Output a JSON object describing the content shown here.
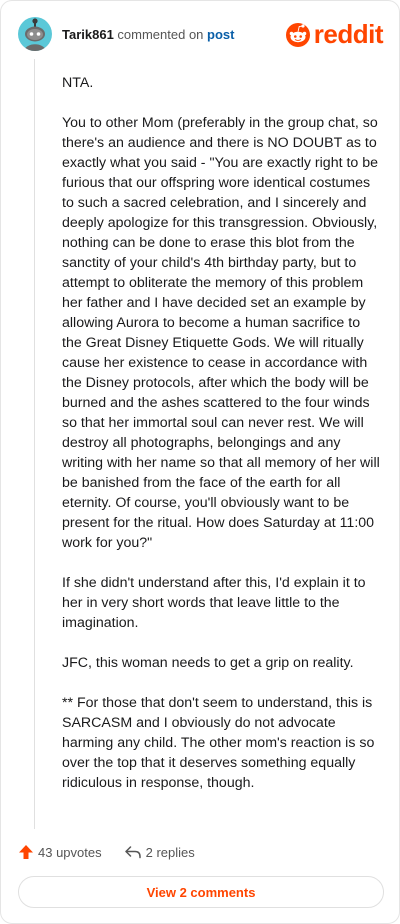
{
  "header": {
    "username": "Tarik861",
    "action_text": "commented on",
    "target": "post",
    "logo_text": "reddit"
  },
  "comment": {
    "paragraphs": [
      "NTA.",
      "You to other Mom (preferably in the group chat, so there's an audience and there is NO DOUBT as to exactly what you said - \"You are exactly right to be furious that our offspring wore identical costumes to such a sacred celebration, and I sincerely and deeply apologize for this transgression. Obviously, nothing can be done to erase this blot from the sanctity of your child's 4th birthday party, but to attempt to obliterate the memory of this problem her father and I have decided set an example by allowing Aurora to become a human sacrifice to the Great Disney Etiquette Gods. We will ritually cause her existence to cease in accordance with the Disney protocols, after which the body will be burned and the ashes scattered to the four winds so that her immortal soul can never rest. We will destroy all photographs, belongings and any writing with her name so that all memory of her will be banished from the face of the earth for all eternity. Of course, you'll obviously want to be present for the ritual. How does Saturday at 11:00 work for you?\"",
      "If she didn't understand after this, I'd explain it to her in very short words that leave little to the imagination.",
      "JFC, this woman needs to get a grip on reality.",
      "** For those that don't seem to understand, this is SARCASM and I obviously do not advocate harming any child. The other mom's reaction is so over the top that it deserves something equally ridiculous in response, though."
    ]
  },
  "footer": {
    "upvotes": "43 upvotes",
    "replies": "2 replies",
    "view_comments": "View 2 comments"
  },
  "colors": {
    "accent": "#ff4500",
    "link": "#0a5fa8",
    "avatar": "#5bc8d8"
  }
}
